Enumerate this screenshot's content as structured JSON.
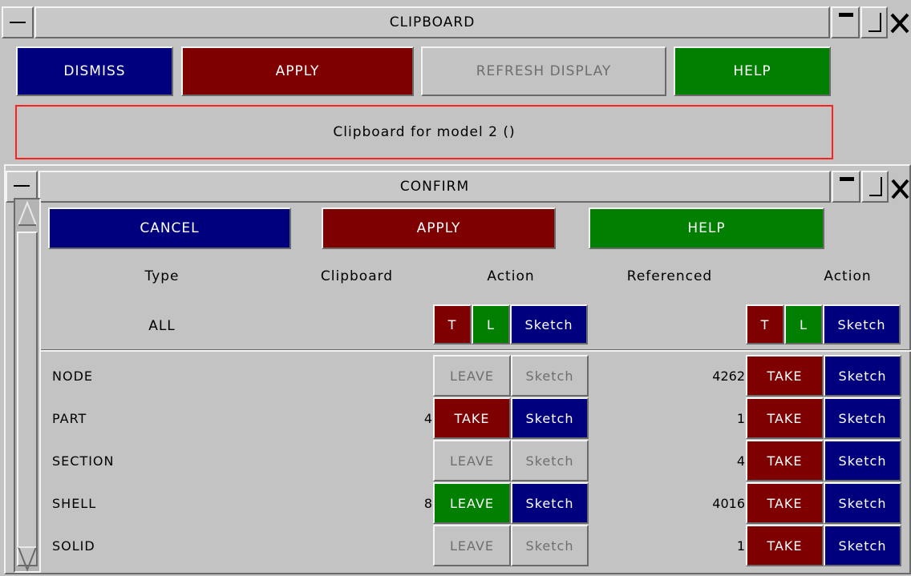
{
  "clipboard_window": {
    "title": "CLIPBOARD",
    "buttons": {
      "dismiss": "DISMISS",
      "apply": "APPLY",
      "refresh": "REFRESH DISPLAY",
      "help": "HELP"
    },
    "message": "Clipboard for model 2 ()"
  },
  "confirm_window": {
    "title": "CONFIRM",
    "buttons": {
      "cancel": "CANCEL",
      "apply": "APPLY",
      "help": "HELP"
    },
    "headers": {
      "type": "Type",
      "clipboard": "Clipboard",
      "action1": "Action",
      "referenced": "Referenced",
      "action2": "Action"
    },
    "all_row": {
      "label": "ALL",
      "t": "T",
      "l": "L",
      "sketch": "Sketch"
    },
    "rows": [
      {
        "type": "NODE",
        "clipboard": "",
        "action": "LEAVE",
        "sketch": "Sketch",
        "referenced": "4262",
        "ref_action": "TAKE",
        "ref_sketch": "Sketch"
      },
      {
        "type": "PART",
        "clipboard": "4",
        "action": "TAKE",
        "sketch": "Sketch",
        "referenced": "1",
        "ref_action": "TAKE",
        "ref_sketch": "Sketch"
      },
      {
        "type": "SECTION",
        "clipboard": "",
        "action": "LEAVE",
        "sketch": "Sketch",
        "referenced": "4",
        "ref_action": "TAKE",
        "ref_sketch": "Sketch"
      },
      {
        "type": "SHELL",
        "clipboard": "8",
        "action": "LEAVE",
        "sketch": "Sketch",
        "referenced": "4016",
        "ref_action": "TAKE",
        "ref_sketch": "Sketch"
      },
      {
        "type": "SOLID",
        "clipboard": "",
        "action": "LEAVE",
        "sketch": "Sketch",
        "referenced": "1",
        "ref_action": "TAKE",
        "ref_sketch": "Sketch"
      }
    ],
    "colors": {
      "blue": "#00007f",
      "red": "#7f0000",
      "green": "#007f00",
      "grey": "#c3c3c3"
    }
  }
}
